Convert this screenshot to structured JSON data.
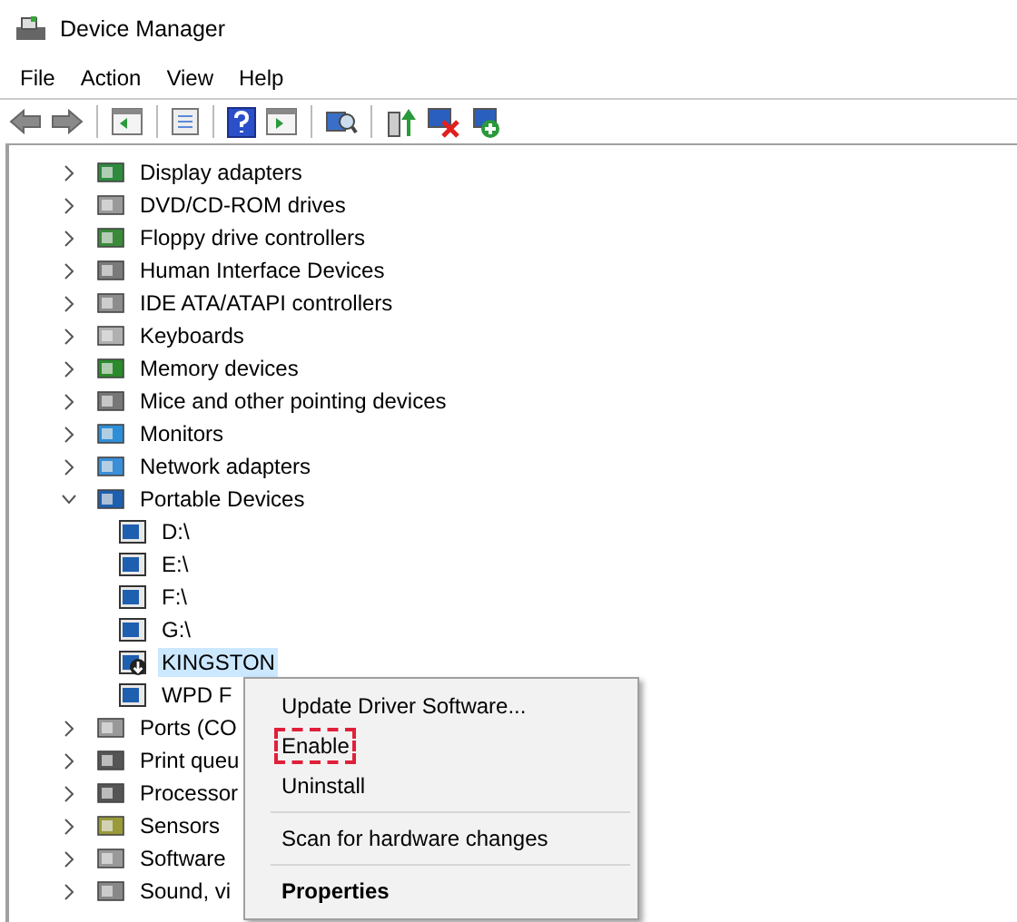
{
  "window": {
    "title": "Device Manager"
  },
  "menu_bar": [
    "File",
    "Action",
    "View",
    "Help"
  ],
  "toolbar": [
    {
      "kind": "back",
      "disabled": false
    },
    {
      "kind": "forward",
      "disabled": false
    },
    {
      "kind": "sep"
    },
    {
      "kind": "tree"
    },
    {
      "kind": "sep"
    },
    {
      "kind": "props"
    },
    {
      "kind": "sep"
    },
    {
      "kind": "help"
    },
    {
      "kind": "pane"
    },
    {
      "kind": "sep"
    },
    {
      "kind": "scan"
    },
    {
      "kind": "sep"
    },
    {
      "kind": "update"
    },
    {
      "kind": "disable"
    },
    {
      "kind": "add"
    }
  ],
  "tree": [
    {
      "label": "Display adapters",
      "expanded": false,
      "selected": false
    },
    {
      "label": "DVD/CD-ROM drives",
      "expanded": false,
      "selected": false
    },
    {
      "label": "Floppy drive controllers",
      "expanded": false,
      "selected": false
    },
    {
      "label": "Human Interface Devices",
      "expanded": false,
      "selected": false
    },
    {
      "label": "IDE ATA/ATAPI controllers",
      "expanded": false,
      "selected": false
    },
    {
      "label": "Keyboards",
      "expanded": false,
      "selected": false
    },
    {
      "label": "Memory devices",
      "expanded": false,
      "selected": false
    },
    {
      "label": "Mice and other pointing devices",
      "expanded": false,
      "selected": false
    },
    {
      "label": "Monitors",
      "expanded": false,
      "selected": false
    },
    {
      "label": "Network adapters",
      "expanded": false,
      "selected": false
    },
    {
      "label": "Portable Devices",
      "expanded": true,
      "selected": false,
      "children": [
        {
          "label": "D:\\",
          "disabled": false,
          "selected": false
        },
        {
          "label": "E:\\",
          "disabled": false,
          "selected": false
        },
        {
          "label": "F:\\",
          "disabled": false,
          "selected": false
        },
        {
          "label": "G:\\",
          "disabled": false,
          "selected": false
        },
        {
          "label": "KINGSTON",
          "disabled": true,
          "selected": true
        },
        {
          "label": "WPD F",
          "disabled": false,
          "selected": false
        }
      ]
    },
    {
      "label": "Ports (CO",
      "expanded": false,
      "selected": false
    },
    {
      "label": "Print queu",
      "expanded": false,
      "selected": false
    },
    {
      "label": "Processor",
      "expanded": false,
      "selected": false
    },
    {
      "label": "Sensors",
      "expanded": false,
      "selected": false
    },
    {
      "label": "Software",
      "expanded": false,
      "selected": false
    },
    {
      "label": "Sound, vi",
      "expanded": false,
      "selected": false
    }
  ],
  "context_menu": [
    {
      "kind": "item",
      "label": "Update Driver Software...",
      "default": false,
      "highlighted": false
    },
    {
      "kind": "item",
      "label": "Enable",
      "default": false,
      "highlighted": true
    },
    {
      "kind": "item",
      "label": "Uninstall",
      "default": false,
      "highlighted": false
    },
    {
      "kind": "separator"
    },
    {
      "kind": "item",
      "label": "Scan for hardware changes",
      "default": false,
      "highlighted": false
    },
    {
      "kind": "separator"
    },
    {
      "kind": "item",
      "label": "Properties",
      "default": true,
      "highlighted": false
    }
  ]
}
